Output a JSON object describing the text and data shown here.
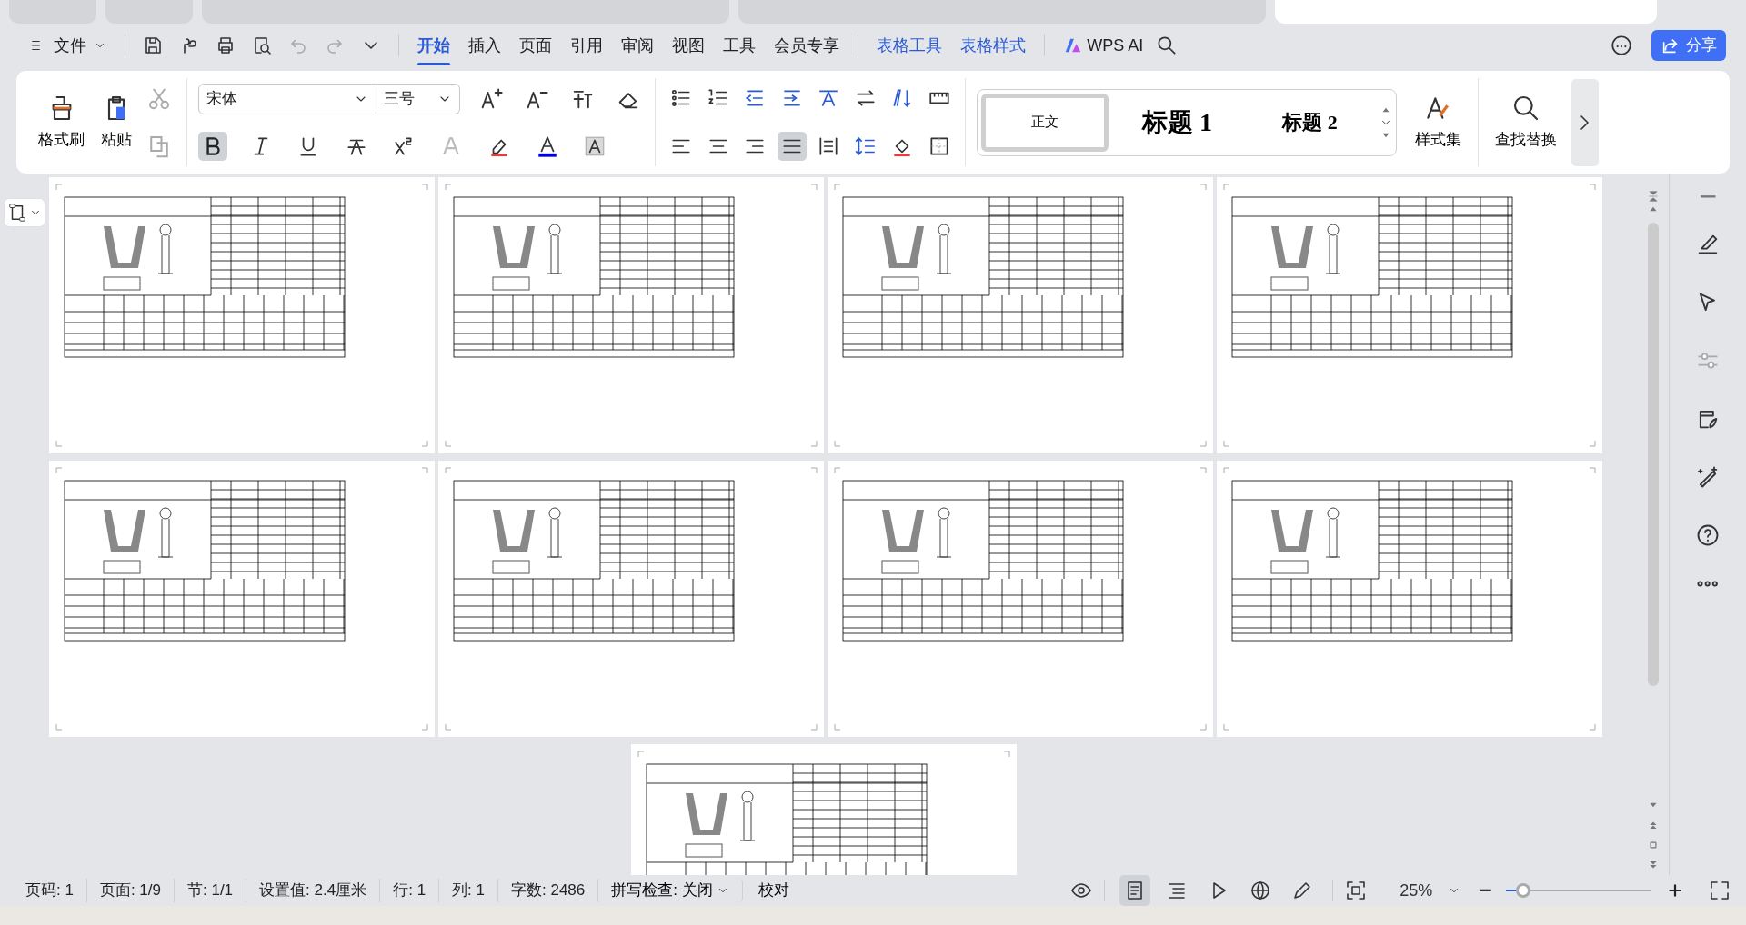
{
  "window_tabs": [
    {
      "kind": "app",
      "selected": false
    },
    {
      "kind": "app",
      "selected": false
    },
    {
      "kind": "doc",
      "selected": false
    },
    {
      "kind": "doc",
      "selected": false
    },
    {
      "kind": "doc",
      "selected": true
    }
  ],
  "menu": {
    "file": "文件",
    "tabs": [
      {
        "label": "开始",
        "kind": "main",
        "selected": true
      },
      {
        "label": "插入",
        "kind": "main",
        "selected": false
      },
      {
        "label": "页面",
        "kind": "main",
        "selected": false
      },
      {
        "label": "引用",
        "kind": "main",
        "selected": false
      },
      {
        "label": "审阅",
        "kind": "main",
        "selected": false
      },
      {
        "label": "视图",
        "kind": "main",
        "selected": false
      },
      {
        "label": "工具",
        "kind": "main",
        "selected": false
      },
      {
        "label": "会员专享",
        "kind": "main",
        "selected": false
      },
      {
        "label": "表格工具",
        "kind": "context",
        "selected": false
      },
      {
        "label": "表格样式",
        "kind": "context",
        "selected": false
      }
    ],
    "ai": "WPS AI",
    "share": "分享"
  },
  "ribbon": {
    "format_painter": "格式刷",
    "paste": "粘贴",
    "font_name": "宋体",
    "font_size": "三号",
    "bold": true,
    "alignments": [
      {
        "selected": false
      },
      {
        "selected": false
      },
      {
        "selected": false
      },
      {
        "selected": true
      }
    ],
    "styles": [
      {
        "label": "正文",
        "selected": true
      },
      {
        "label": "标题 1",
        "selected": false
      },
      {
        "label": "标题 2",
        "selected": false
      }
    ],
    "style_set": "样式集",
    "find_replace": "查找替换"
  },
  "status_bar": {
    "items": [
      "页码: 1",
      "页面: 1/9",
      "节: 1/1",
      "设置值: 2.4厘米",
      "行: 1",
      "列: 1",
      "字数: 2486"
    ],
    "spell_check": "拼写检查: 关闭",
    "proofread": "校对",
    "view_modes": [
      {
        "selected": true
      },
      {
        "selected": false
      },
      {
        "selected": false
      },
      {
        "selected": false
      },
      {
        "selected": false
      }
    ],
    "zoom": "25%",
    "zoom_slider": {
      "level": 0.12
    }
  }
}
